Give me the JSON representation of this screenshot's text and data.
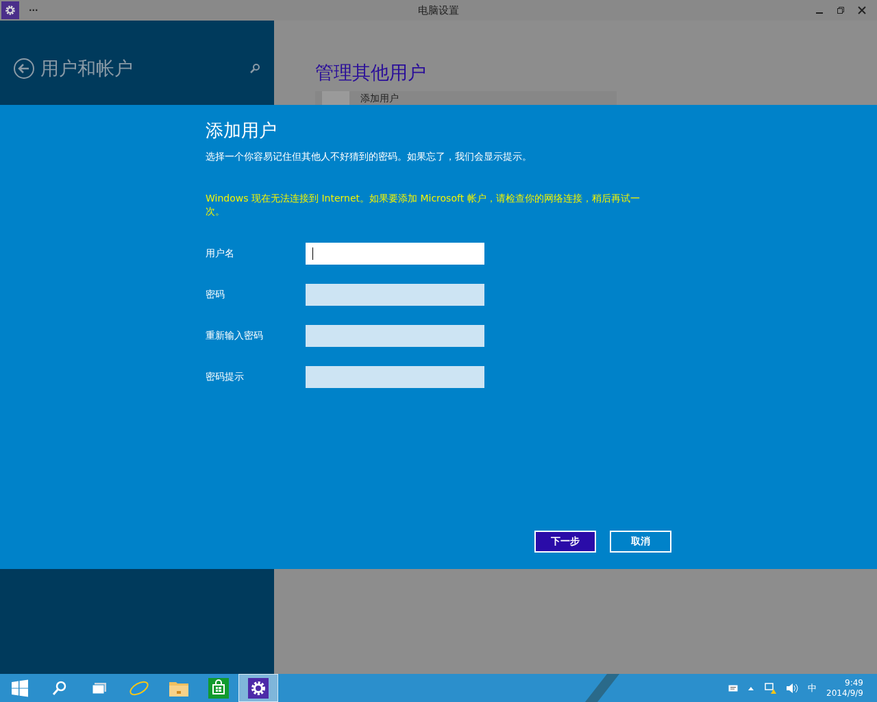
{
  "window": {
    "title": "电脑设置",
    "menu": "···"
  },
  "sidebar": {
    "title": "用户和帐户"
  },
  "main": {
    "heading": "管理其他用户",
    "items": [
      {
        "label": "添加用户"
      }
    ]
  },
  "dialog": {
    "title": "添加用户",
    "description": "选择一个你容易记住但其他人不好猜到的密码。如果忘了，我们会显示提示。",
    "warning": "Windows 现在无法连接到 Internet。如果要添加 Microsoft 帐户，请检查你的网络连接，稍后再试一次。",
    "fields": [
      {
        "label": "用户名",
        "focused": true
      },
      {
        "label": "密码",
        "focused": false
      },
      {
        "label": "重新输入密码",
        "focused": false
      },
      {
        "label": "密码提示",
        "focused": false
      }
    ],
    "buttons": [
      {
        "label": "下一步",
        "kind": "primary"
      },
      {
        "label": "取消",
        "kind": "secondary"
      }
    ]
  },
  "taskbar": {
    "apps": [
      {
        "kind": "start",
        "selected": false
      },
      {
        "kind": "search",
        "selected": false
      },
      {
        "kind": "taskview",
        "selected": false
      },
      {
        "kind": "browser",
        "selected": false
      },
      {
        "kind": "folder",
        "selected": false
      },
      {
        "kind": "store",
        "selected": false
      },
      {
        "kind": "settings",
        "selected": true
      }
    ],
    "ime": "中",
    "time": "9:49",
    "date": "2014/9/9"
  }
}
